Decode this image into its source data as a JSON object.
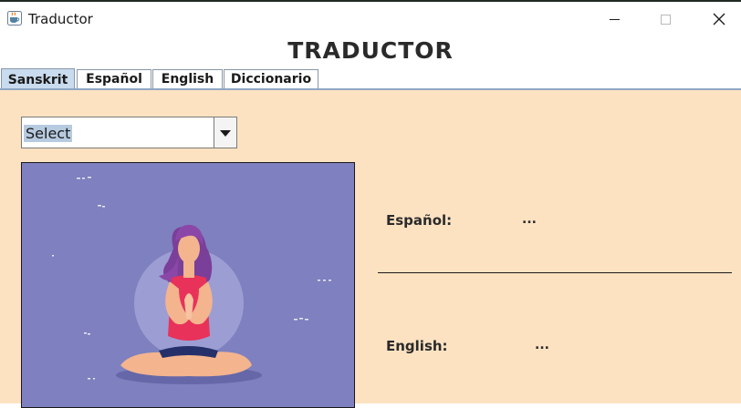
{
  "window": {
    "title": "Traductor",
    "icon": "java-coffee-cup-icon"
  },
  "app": {
    "heading": "TRADUCTOR"
  },
  "tabs": [
    {
      "label": "Sanskrit",
      "active": true
    },
    {
      "label": "Español",
      "active": false
    },
    {
      "label": "English",
      "active": false
    },
    {
      "label": "Diccionario",
      "active": false
    }
  ],
  "selector": {
    "value": "Select"
  },
  "translation": {
    "spanish_label": "Español:",
    "spanish_value": "...",
    "english_label": "English:",
    "english_value": "..."
  },
  "colors": {
    "content_bg": "#fde2c2",
    "active_tab": "#c9dbee",
    "image_bg": "#7e80bf"
  }
}
